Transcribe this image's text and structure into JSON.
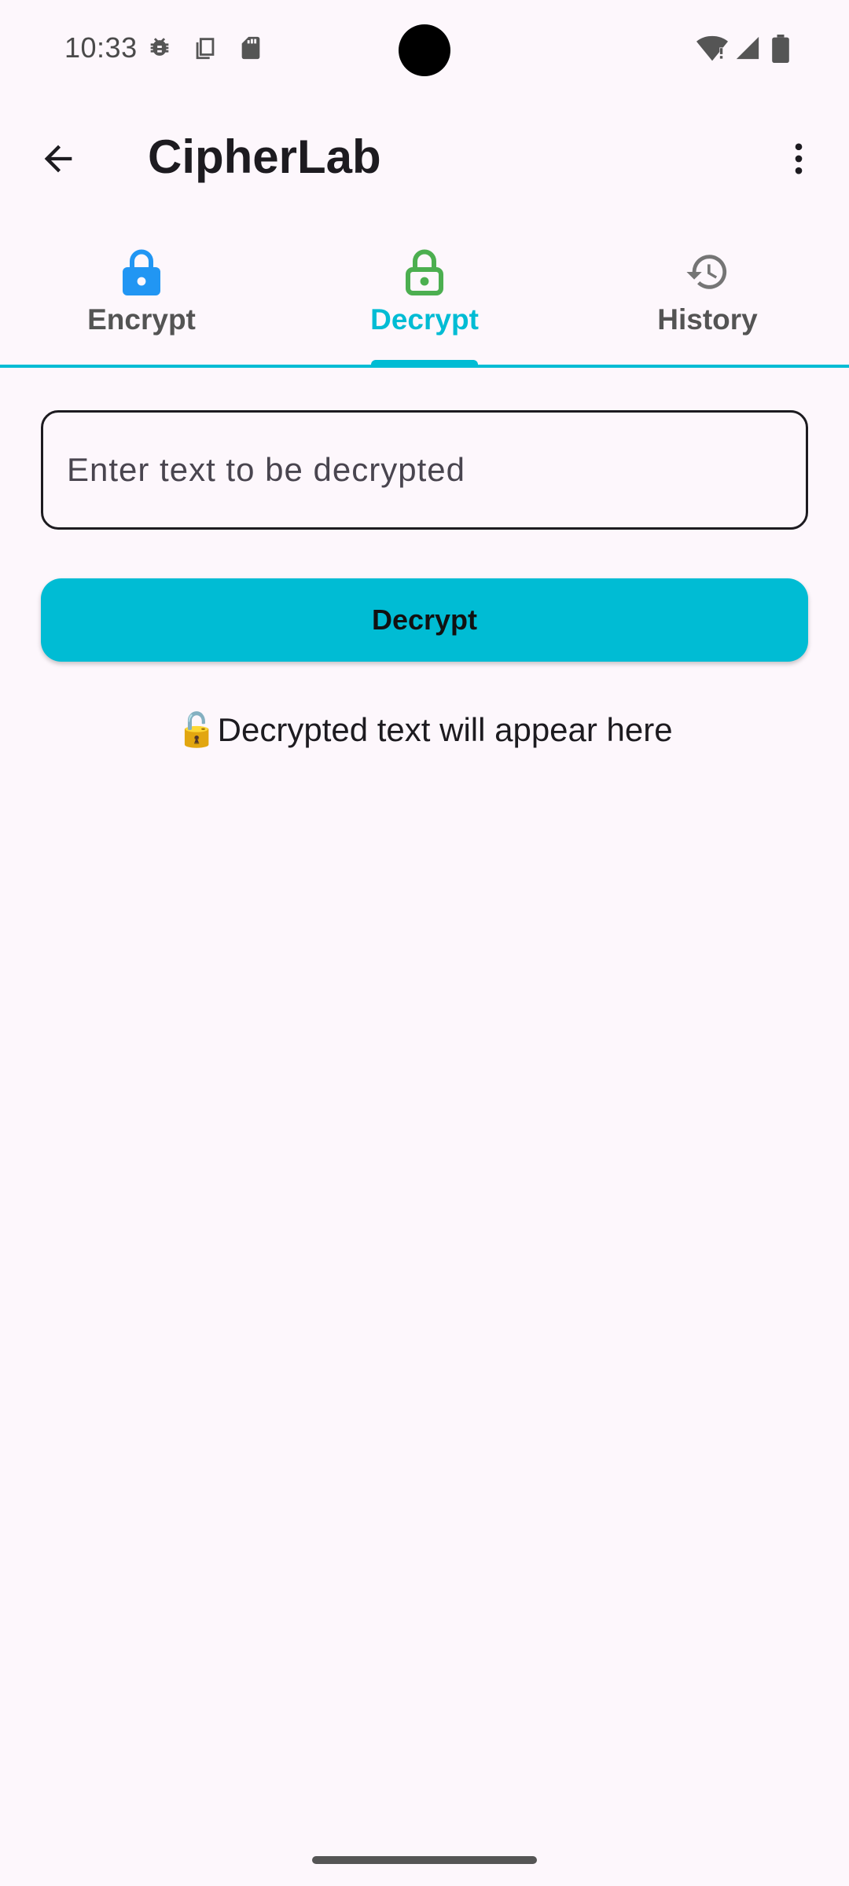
{
  "status_bar": {
    "time": "10:33",
    "left_icons": [
      "bug-icon",
      "copy-icon",
      "sd-card-icon"
    ],
    "right_icons": [
      "wifi-alert-icon",
      "signal-icon",
      "battery-icon"
    ]
  },
  "app_bar": {
    "title": "CipherLab",
    "back_icon": "arrow-back-icon",
    "menu_icon": "more-vert-icon"
  },
  "tabs": [
    {
      "label": "Encrypt",
      "icon": "lock-closed-icon",
      "icon_color": "#2196f3",
      "active": false
    },
    {
      "label": "Decrypt",
      "icon": "lock-open-icon",
      "icon_color": "#4caf50",
      "active": true
    },
    {
      "label": "History",
      "icon": "history-icon",
      "icon_color": "#757575",
      "active": false
    }
  ],
  "decrypt_form": {
    "input_value": "",
    "input_placeholder": "Enter text to be decrypted",
    "button_label": "Decrypt",
    "result_text": "🔓Decrypted text will appear here"
  },
  "colors": {
    "accent": "#00bcd4",
    "background": "#fdf7fc"
  }
}
